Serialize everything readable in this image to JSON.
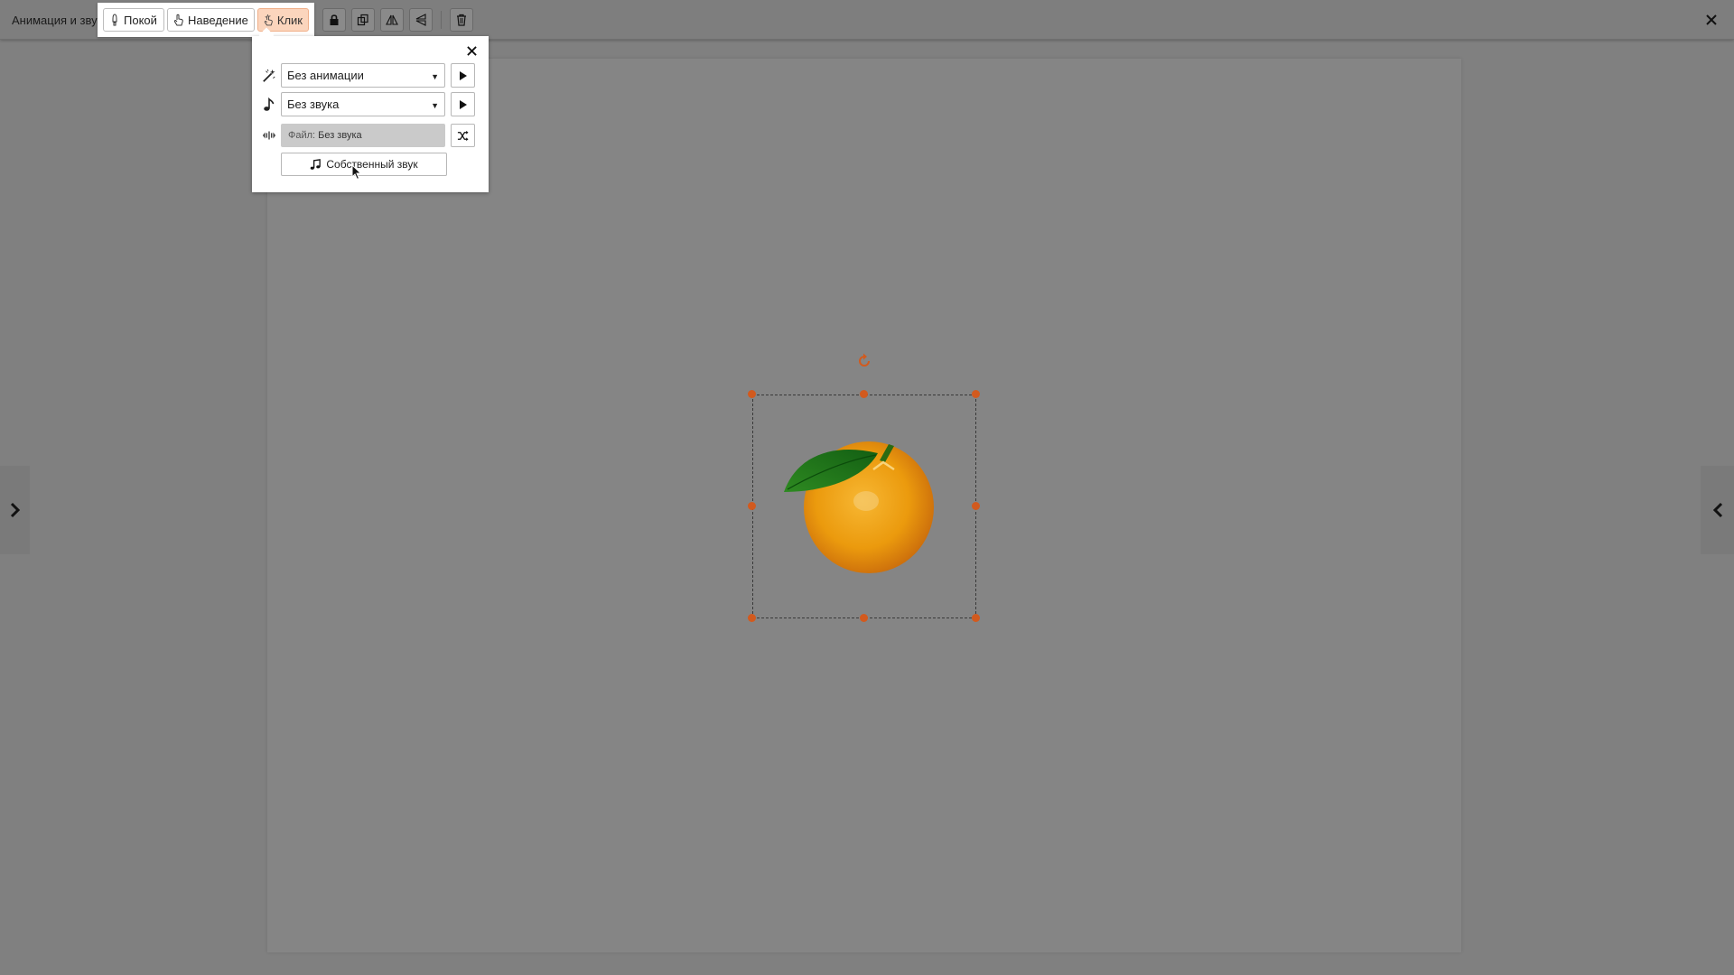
{
  "toolbar": {
    "title": "Анимация и звук",
    "states": [
      {
        "label": "Покой",
        "active": false
      },
      {
        "label": "Наведение",
        "active": false
      },
      {
        "label": "Клик",
        "active": true
      }
    ],
    "tools": [
      "lock-icon",
      "duplicate-icon",
      "flip-horizontal-icon",
      "flip-vertical-icon",
      "trash-icon"
    ],
    "close_icon": "close-icon"
  },
  "popup": {
    "animation": {
      "icon": "magic-wand-icon",
      "value": "Без анимации"
    },
    "sound": {
      "icon": "music-note-icon",
      "value": "Без звука"
    },
    "file": {
      "icon": "audio-wave-icon",
      "prefix": "Файл:",
      "value": "Без звука"
    },
    "custom_sound_label": "Собственный звук",
    "shuffle_icon": "shuffle-icon",
    "close_icon": "close-icon"
  },
  "canvas": {
    "object": "orange-image",
    "selected": true
  },
  "colors": {
    "accent": "#d25a1e",
    "active_state_bg": "#fbd5bd",
    "overlay": "#808080"
  }
}
